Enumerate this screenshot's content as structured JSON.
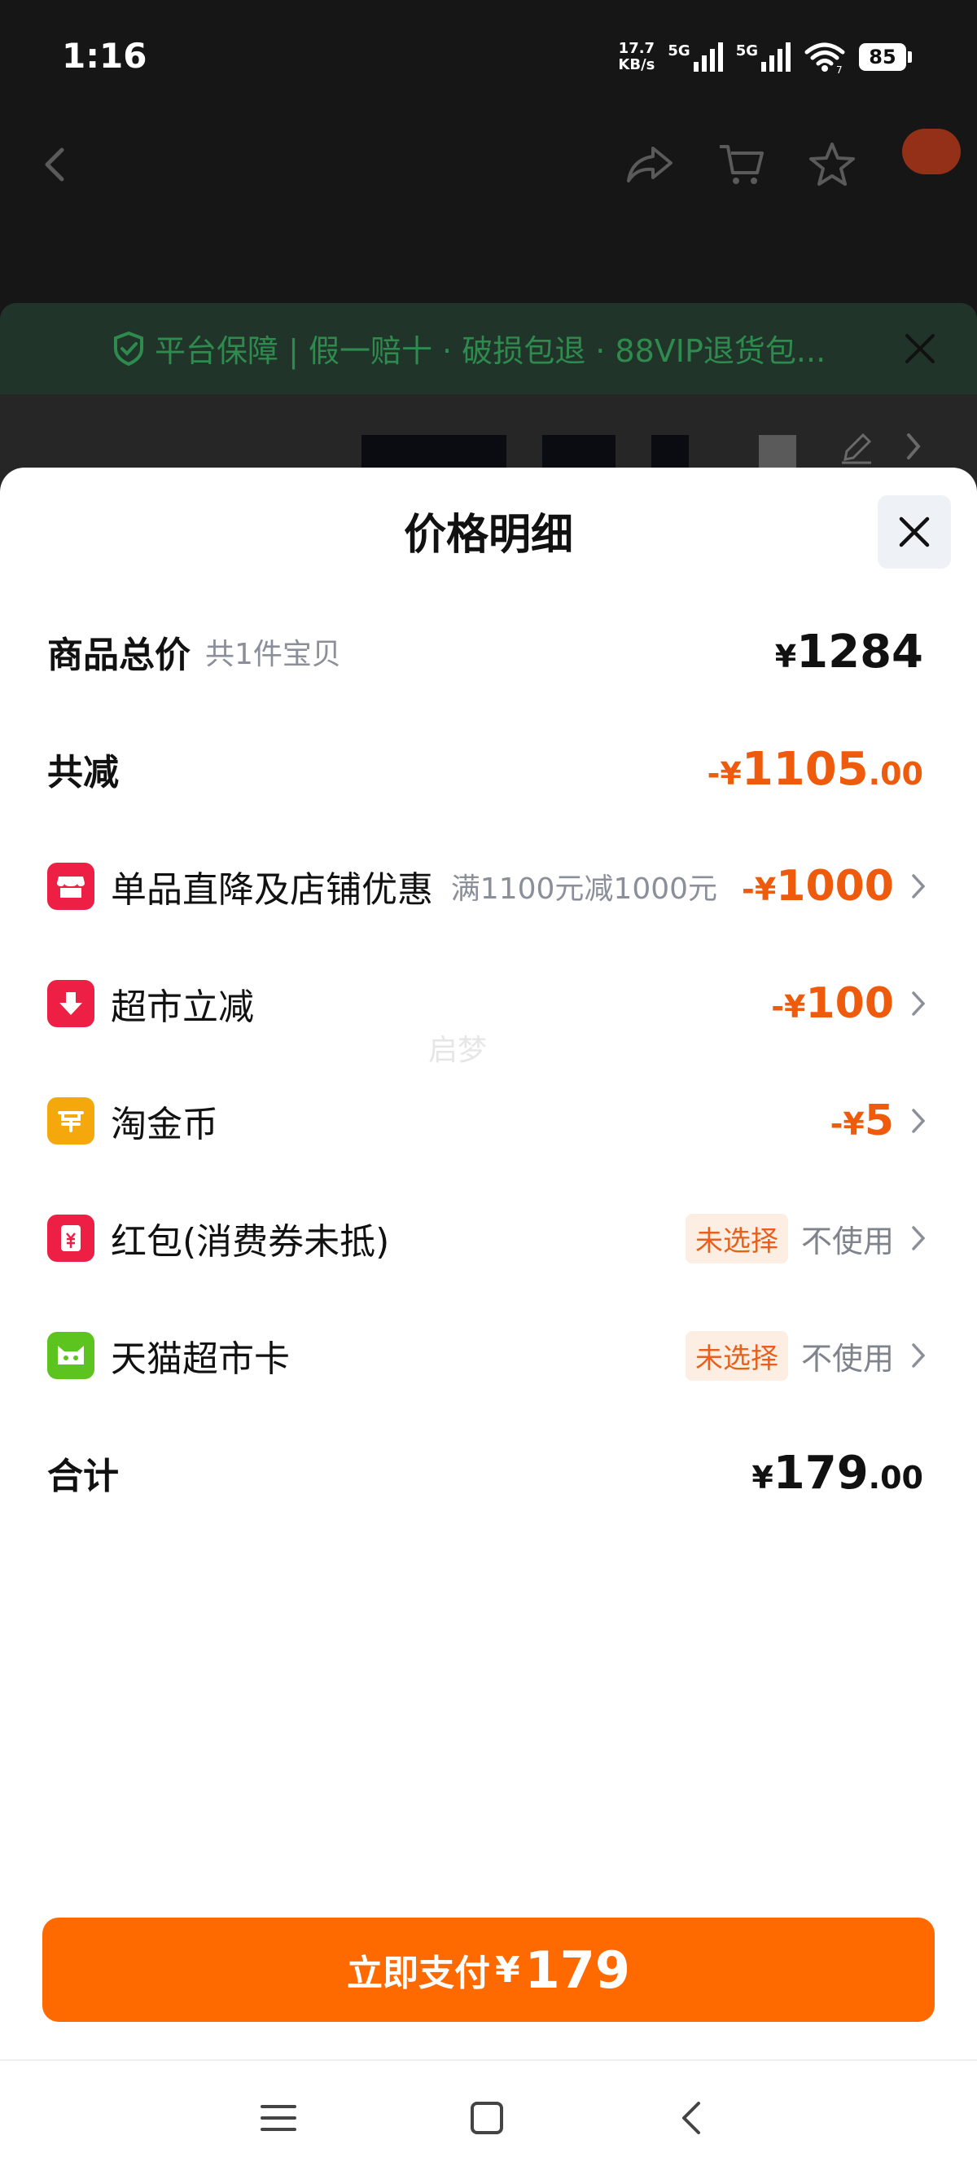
{
  "status_bar": {
    "time": "1:16",
    "speed_value": "17.7",
    "speed_unit": "KB/s",
    "network1": "5G",
    "network2": "5G",
    "wifi_badge": "7",
    "battery": "85"
  },
  "background": {
    "guarantee_text": "平台保障 | 假一赔十 · 破损包退 · 88VIP退货包..."
  },
  "sheet": {
    "title": "价格明细",
    "watermark": "启梦",
    "rows": {
      "total": {
        "label": "商品总价",
        "sub": "共1件宝贝",
        "symbol": "¥",
        "amount": "1284"
      },
      "reduced": {
        "label": "共减",
        "prefix": "-¥",
        "amount": "1105",
        "decimal": ".00"
      },
      "store_discount": {
        "label": "单品直降及店铺优惠",
        "note": "满1100元减1000元",
        "prefix": "-¥",
        "amount": "1000"
      },
      "supermarket_cut": {
        "label": "超市立减",
        "prefix": "-¥",
        "amount": "100"
      },
      "gold_coin": {
        "label": "淘金币",
        "prefix": "-¥",
        "amount": "5"
      },
      "red_packet": {
        "label": "红包(消费券未抵)",
        "tag": "未选择",
        "status": "不使用"
      },
      "tmall_card": {
        "label": "天猫超市卡",
        "tag": "未选择",
        "status": "不使用"
      },
      "sum": {
        "label": "合计",
        "symbol": "¥",
        "amount": "179",
        "decimal": ".00"
      }
    },
    "pay_button": {
      "label": "立即支付",
      "symbol": "¥",
      "amount": "179"
    }
  },
  "colors": {
    "accent_orange": "#ff6a00",
    "discount_orange": "#ef5b0c",
    "store_icon_red": "#ee1f45",
    "coin_yellow": "#f5a80c",
    "card_green": "#5cc31f"
  }
}
